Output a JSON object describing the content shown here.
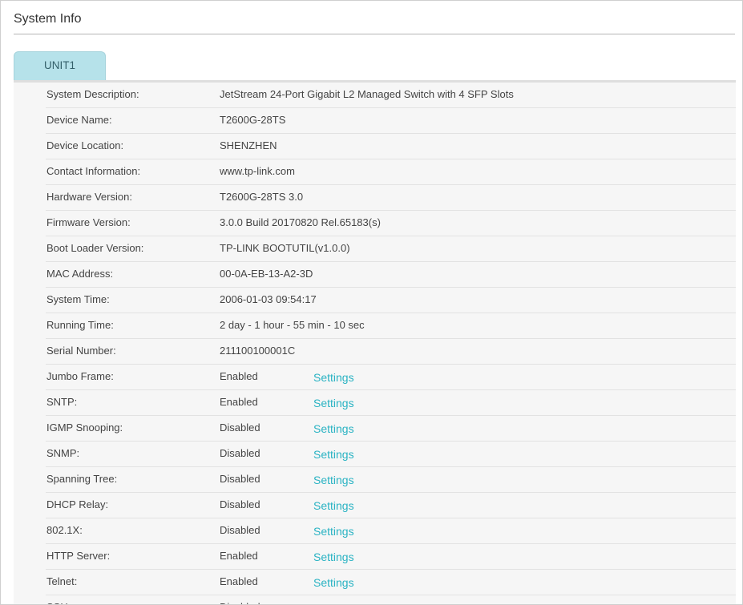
{
  "page": {
    "title": "System Info"
  },
  "tabs": [
    {
      "label": "UNIT1"
    }
  ],
  "rows": [
    {
      "label": "System Description:",
      "value": "JetStream 24-Port Gigabit L2 Managed Switch with 4 SFP Slots"
    },
    {
      "label": "Device Name:",
      "value": "T2600G-28TS"
    },
    {
      "label": "Device Location:",
      "value": "SHENZHEN"
    },
    {
      "label": "Contact Information:",
      "value": "www.tp-link.com"
    },
    {
      "label": "Hardware Version:",
      "value": "T2600G-28TS 3.0"
    },
    {
      "label": "Firmware Version:",
      "value": "3.0.0 Build 20170820 Rel.65183(s)"
    },
    {
      "label": "Boot Loader Version:",
      "value": "TP-LINK BOOTUTIL(v1.0.0)"
    },
    {
      "label": "MAC Address:",
      "value": "00-0A-EB-13-A2-3D"
    },
    {
      "label": "System Time:",
      "value": "2006-01-03 09:54:17"
    },
    {
      "label": "Running Time:",
      "value": "2 day - 1 hour - 55 min - 10 sec"
    },
    {
      "label": "Serial Number:",
      "value": "211100100001C"
    },
    {
      "label": "Jumbo Frame:",
      "value": "Enabled",
      "link": "Settings"
    },
    {
      "label": "SNTP:",
      "value": "Enabled",
      "link": "Settings"
    },
    {
      "label": "IGMP Snooping:",
      "value": "Disabled",
      "link": "Settings"
    },
    {
      "label": "SNMP:",
      "value": "Disabled",
      "link": "Settings"
    },
    {
      "label": "Spanning Tree:",
      "value": "Disabled",
      "link": "Settings"
    },
    {
      "label": "DHCP Relay:",
      "value": "Disabled",
      "link": "Settings"
    },
    {
      "label": "802.1X:",
      "value": "Disabled",
      "link": "Settings"
    },
    {
      "label": "HTTP Server:",
      "value": "Enabled",
      "link": "Settings"
    },
    {
      "label": "Telnet:",
      "value": "Enabled",
      "link": "Settings"
    },
    {
      "label": "SSH:",
      "value": "Disabled",
      "link": "Settings"
    }
  ],
  "colors": {
    "link": "#2ab3c3",
    "tab_active": "#b6e2ea",
    "panel_bg": "#f6f6f6"
  }
}
